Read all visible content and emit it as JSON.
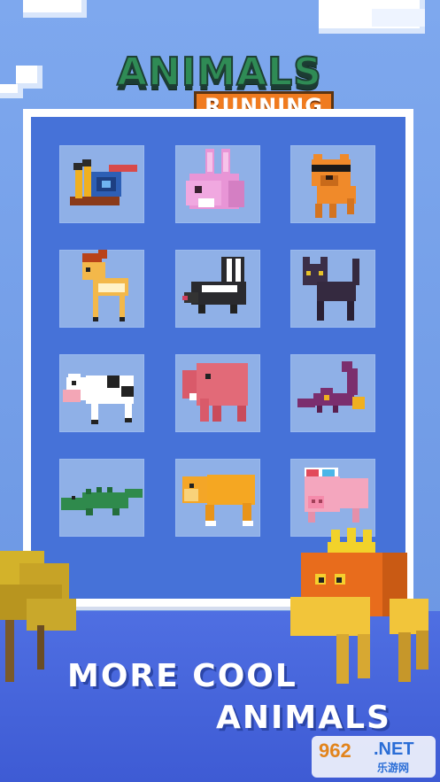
{
  "title": {
    "line1": "ANIMALS",
    "line2": "RUNNING"
  },
  "tagline": {
    "line1": "MORE COOL",
    "line2": "ANIMALS"
  },
  "watermark": {
    "number": "962",
    "suffix": ".NET",
    "sub": "乐游网"
  },
  "animals": [
    "snail-icon",
    "rabbit-icon",
    "dog-with-sunglasses-icon",
    "deer-icon",
    "skunk-icon",
    "black-cat-icon",
    "cow-icon",
    "elephant-icon",
    "scorpion-icon",
    "crocodile-icon",
    "lion-icon",
    "pig-with-3d-glasses-icon"
  ],
  "colors": {
    "sky": "#7ea8ee",
    "board": "#4672d8",
    "tile": "#8fb0e7",
    "ground": "#4463d8"
  }
}
